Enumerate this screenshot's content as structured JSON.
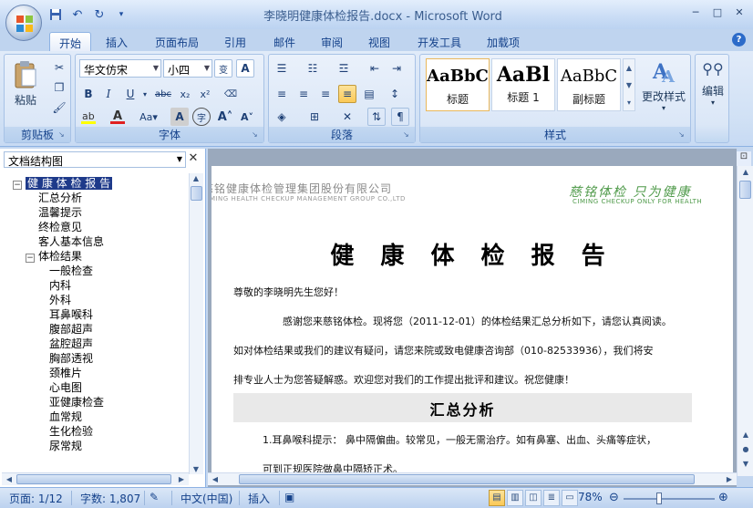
{
  "window": {
    "title": "李晓明健康体检报告.docx - Microsoft Word",
    "minimize": "─",
    "maximize": "□",
    "close": "✕"
  },
  "qat": {
    "save": "💾",
    "undo": "↶",
    "redo": "↻",
    "more": "▾"
  },
  "tabs": [
    {
      "label": "开始",
      "active": true
    },
    {
      "label": "插入"
    },
    {
      "label": "页面布局"
    },
    {
      "label": "引用"
    },
    {
      "label": "邮件"
    },
    {
      "label": "审阅"
    },
    {
      "label": "视图"
    },
    {
      "label": "开发工具"
    },
    {
      "label": "加载项"
    }
  ],
  "help": "?",
  "ribbon": {
    "clipboard": {
      "label": "剪贴板",
      "paste": "粘贴"
    },
    "font": {
      "label": "字体",
      "font_name": "华文仿宋",
      "font_size": "小四"
    },
    "paragraph": {
      "label": "段落"
    },
    "styles": {
      "label": "样式",
      "items": [
        {
          "sample": "AaBbC",
          "name": "标题"
        },
        {
          "sample": "AaBl",
          "name": "标题 1"
        },
        {
          "sample": "AaBbC",
          "name": "副标题"
        }
      ],
      "change_styles": "更改样式"
    },
    "editing": {
      "label": "编辑"
    }
  },
  "nav": {
    "header": "文档结构图",
    "close": "✕",
    "items": [
      {
        "label": "健 康 体 检 报 告",
        "level": 0,
        "toggle": "⊟",
        "selected": true
      },
      {
        "label": "汇总分析",
        "level": 1
      },
      {
        "label": "温馨提示",
        "level": 1
      },
      {
        "label": "终检意见",
        "level": 1
      },
      {
        "label": "客人基本信息",
        "level": 1
      },
      {
        "label": "体检结果",
        "level": 1,
        "toggle": "⊟"
      },
      {
        "label": "一般检查",
        "level": 2
      },
      {
        "label": "内科",
        "level": 2
      },
      {
        "label": "外科",
        "level": 2
      },
      {
        "label": "耳鼻喉科",
        "level": 2
      },
      {
        "label": "腹部超声",
        "level": 2
      },
      {
        "label": "盆腔超声",
        "level": 2
      },
      {
        "label": "胸部透视",
        "level": 2
      },
      {
        "label": "颈椎片",
        "level": 2
      },
      {
        "label": "心电图",
        "level": 2
      },
      {
        "label": "亚健康检查",
        "level": 2
      },
      {
        "label": "血常规",
        "level": 2
      },
      {
        "label": "生化检验",
        "level": 2
      },
      {
        "label": "尿常规",
        "level": 2
      }
    ]
  },
  "doc": {
    "header_left": "慈铭健康体检管理集团股份有限公司",
    "header_left_en": "CIMING HEALTH CHECKUP MANAGEMENT GROUP CO.,LTD",
    "header_right": "慈铭体检  只为健康",
    "header_right_en": "CIMING CHECKUP        ONLY FOR HEALTH",
    "title": "健 康 体 检 报 告",
    "greeting": "尊敬的李晓明先生您好！",
    "para1": "感谢您来慈铭体检。现将您（2011-12-01）的体检结果汇总分析如下，请您认真阅读。",
    "para2": "如对体检结果或我们的建议有疑问，请您来院或致电健康咨询部（010-82533936），我们将安",
    "para3": "排专业人士为您答疑解惑。欢迎您对我们的工作提出批评和建议。祝您健康！",
    "summary_title": "汇总分析",
    "para4": "1.耳鼻喉科提示：  鼻中隔偏曲。较常见，一般无需治疗。如有鼻塞、出血、头痛等症状，",
    "para5": "可到正规医院做鼻中隔矫正术。"
  },
  "status": {
    "page": "页面: 1/12",
    "words": "字数: 1,807",
    "lang": "中文(中国)",
    "mode": "插入",
    "zoom": "78%",
    "zoom_level": 78
  }
}
